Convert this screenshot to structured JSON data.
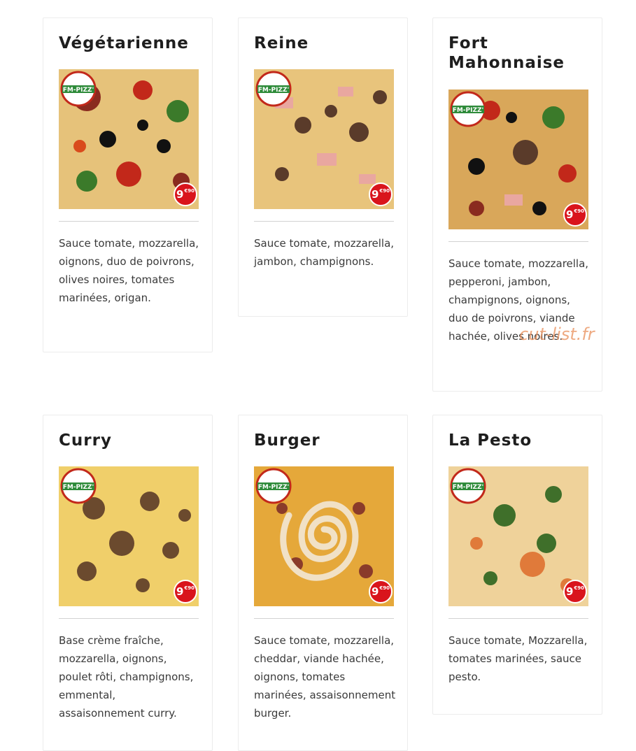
{
  "pizzas": [
    {
      "name": "Végétarienne",
      "description": "Sauce tomate, mozzarella, oignons, duo de poivrons, olives noires, tomates marinées, origan.",
      "price_euros": "9",
      "price_cents": "€90",
      "logo_text": "FM-PIZZ'"
    },
    {
      "name": "Reine",
      "description": "Sauce tomate, mozzarella, jambon, champignons.",
      "price_euros": "9",
      "price_cents": "€90",
      "logo_text": "FM-PIZZ'"
    },
    {
      "name": "Fort Mahonnaise",
      "description": "Sauce tomate, mozzarella, pepperoni, jambon, champignons, oignons, duo de poivrons, viande hachée, olives noires.",
      "price_euros": "9",
      "price_cents": "€90",
      "logo_text": "FM-PIZZ'"
    },
    {
      "name": "Curry",
      "description": "Base crème fraîche, mozzarella, oignons, poulet rôti, champignons, emmental, assaisonnement curry.",
      "price_euros": "9",
      "price_cents": "€90",
      "logo_text": "FM-PIZZ'"
    },
    {
      "name": "Burger",
      "description": "Sauce tomate, mozzarella, cheddar, viande hachée, oignons, tomates marinées, assaisonnement burger.",
      "price_euros": "9",
      "price_cents": "€90",
      "logo_text": "FM-PIZZ'"
    },
    {
      "name": "La Pesto",
      "description": "Sauce tomate, Mozzarella, tomates marinées, sauce pesto.",
      "price_euros": "9",
      "price_cents": "€90",
      "logo_text": "FM-PIZZ'"
    }
  ],
  "watermark": "cut-list.fr",
  "colors": {
    "price_badge": "#d9141c",
    "watermark": "#e88e58",
    "card_border": "#ececec",
    "title": "#1e1e1e"
  }
}
